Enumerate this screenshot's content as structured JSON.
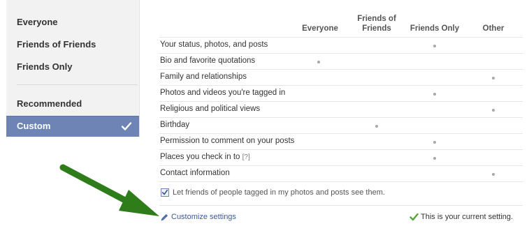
{
  "sidebar": {
    "items": [
      {
        "label": "Everyone",
        "selected": false
      },
      {
        "label": "Friends of Friends",
        "selected": false
      },
      {
        "label": "Friends Only",
        "selected": false
      },
      {
        "label": "Recommended",
        "selected": false
      },
      {
        "label": "Custom",
        "selected": true
      }
    ],
    "selected_color": "#6d84b4"
  },
  "table": {
    "columns": [
      "Everyone",
      "Friends of Friends",
      "Friends Only",
      "Other"
    ],
    "rows": [
      {
        "label": "Your status, photos, and posts",
        "setting": "Friends Only"
      },
      {
        "label": "Bio and favorite quotations",
        "setting": "Everyone"
      },
      {
        "label": "Family and relationships",
        "setting": "Other"
      },
      {
        "label": "Photos and videos you're tagged in",
        "setting": "Friends Only"
      },
      {
        "label": "Religious and political views",
        "setting": "Other"
      },
      {
        "label": "Birthday",
        "setting": "Friends of Friends"
      },
      {
        "label": "Permission to comment on your posts",
        "setting": "Friends Only"
      },
      {
        "label": "Places you check in to",
        "hint": "[?]",
        "setting": "Friends Only"
      },
      {
        "label": "Contact information",
        "setting": "Other"
      }
    ]
  },
  "tag_option": {
    "label": "Let friends of people tagged in my photos and posts see them.",
    "checked": true
  },
  "footer": {
    "customize_label": "Customize settings",
    "current_setting_text": "This is your current setting."
  },
  "colors": {
    "link": "#3b5998",
    "annotation_arrow": "#2e7d1a",
    "check_green": "#5aa33a"
  }
}
